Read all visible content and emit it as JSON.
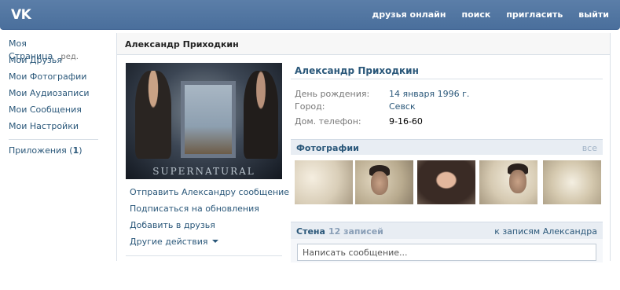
{
  "header": {
    "logo": "VK",
    "nav": [
      "друзья онлайн",
      "поиск",
      "пригласить",
      "выйти"
    ]
  },
  "sidebar": {
    "my_page": "Моя Страница",
    "edit": "ред.",
    "items": [
      "Мои Друзья",
      "Мои Фотографии",
      "Мои Аудиозаписи",
      "Мои Сообщения",
      "Мои Настройки"
    ],
    "apps_label": "Приложения (",
    "apps_count": "1",
    "apps_close": ")"
  },
  "main": {
    "header_title": "Александр Приходкин"
  },
  "avatar": {
    "caption": "SUPERNATURAL"
  },
  "actions": {
    "send_message": "Отправить Александру сообщение",
    "subscribe": "Подписаться на обновления",
    "add_friend": "Добавить в друзья",
    "other": "Другие действия"
  },
  "profile": {
    "name": "Александр Приходкин",
    "birthday_label": "День рождения:",
    "birthday_value": "14 января 1996 г.",
    "city_label": "Город:",
    "city_value": "Севск",
    "phone_label": "Дом. телефон:",
    "phone_value": "9-16-60"
  },
  "photos": {
    "title": "Фотографии",
    "all": "все"
  },
  "wall": {
    "title": "Стена",
    "count": "12 записей",
    "link": "к записям Александра",
    "placeholder": "Написать сообщение..."
  },
  "colors": {
    "header_bg": "#4a6f9c",
    "link": "#2b587a",
    "section_bar": "#e8edf3"
  }
}
